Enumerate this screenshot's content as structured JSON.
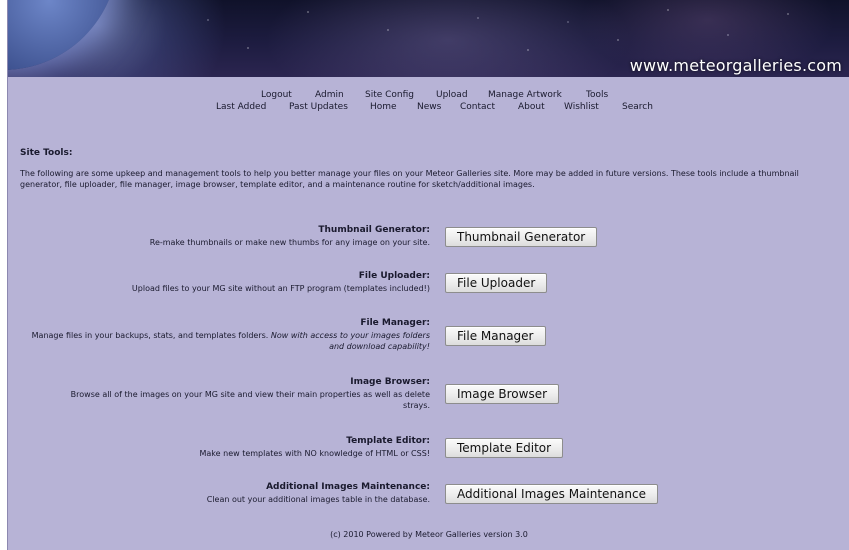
{
  "site": {
    "url": "www.meteorgalleries.com"
  },
  "nav": {
    "row1": [
      "Logout",
      "Admin",
      "Site Config",
      "Upload",
      "Manage Artwork",
      "Tools"
    ],
    "row2": [
      "Last Added",
      "Past Updates",
      "Home",
      "News",
      "Contact",
      "About",
      "Wishlist",
      "Search"
    ]
  },
  "page": {
    "section_title": "Site Tools:",
    "intro": "The following are some upkeep and management tools to help you better manage your files on your Meteor Galleries site. More may be added in future versions. These tools include a thumbnail generator, file uploader, file manager, image browser, template editor, and a maintenance routine for sketch/additional images."
  },
  "tools": [
    {
      "title": "Thumbnail Generator:",
      "desc": "Re-make thumbnails or make new thumbs for any image on your site.",
      "button": "Thumbnail Generator"
    },
    {
      "title": "File Uploader:",
      "desc": "Upload files to your MG site without an FTP program (templates included!)",
      "button": "File Uploader"
    },
    {
      "title": "File Manager:",
      "desc": "Manage files in your backups, stats, and templates folders.",
      "desc_em": "Now with access to your images folders and download capability!",
      "button": "File Manager"
    },
    {
      "title": "Image Browser:",
      "desc": "Browse all of the images on your MG site and view their main properties as well as delete strays.",
      "button": "Image Browser"
    },
    {
      "title": "Template Editor:",
      "desc": "Make new templates with NO knowledge of HTML or CSS!",
      "button": "Template Editor"
    },
    {
      "title": "Additional Images Maintenance:",
      "desc": "Clean out your additional images table in the database.",
      "button": "Additional Images Maintenance"
    }
  ],
  "footer": {
    "text": "(c) 2010 Powered by Meteor Galleries version 3.0"
  }
}
